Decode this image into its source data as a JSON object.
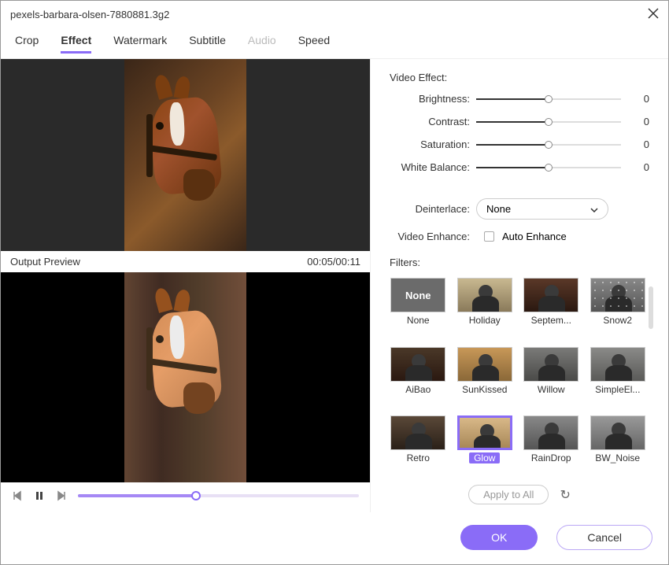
{
  "window": {
    "title": "pexels-barbara-olsen-7880881.3g2"
  },
  "tabs": {
    "items": [
      "Crop",
      "Effect",
      "Watermark",
      "Subtitle",
      "Audio",
      "Speed"
    ],
    "active": "Effect",
    "disabled": "Audio"
  },
  "preview": {
    "label": "Output Preview",
    "time": "00:05/00:11"
  },
  "effects": {
    "section_label": "Video Effect:",
    "sliders": [
      {
        "label": "Brightness:",
        "value": "0"
      },
      {
        "label": "Contrast:",
        "value": "0"
      },
      {
        "label": "Saturation:",
        "value": "0"
      },
      {
        "label": "White Balance:",
        "value": "0"
      }
    ],
    "deinterlace": {
      "label": "Deinterlace:",
      "value": "None"
    },
    "enhance": {
      "label": "Video Enhance:",
      "checkbox_label": "Auto Enhance"
    }
  },
  "filters": {
    "section_label": "Filters:",
    "none_label": "None",
    "items": [
      {
        "name": "None",
        "selected": false
      },
      {
        "name": "Holiday",
        "selected": false
      },
      {
        "name": "Septem...",
        "selected": false
      },
      {
        "name": "Snow2",
        "selected": false
      },
      {
        "name": "AiBao",
        "selected": false
      },
      {
        "name": "SunKissed",
        "selected": false
      },
      {
        "name": "Willow",
        "selected": false
      },
      {
        "name": "SimpleEl...",
        "selected": false
      },
      {
        "name": "Retro",
        "selected": false
      },
      {
        "name": "Glow",
        "selected": true
      },
      {
        "name": "RainDrop",
        "selected": false
      },
      {
        "name": "BW_Noise",
        "selected": false
      }
    ],
    "apply_all": "Apply to All"
  },
  "footer": {
    "ok": "OK",
    "cancel": "Cancel"
  }
}
